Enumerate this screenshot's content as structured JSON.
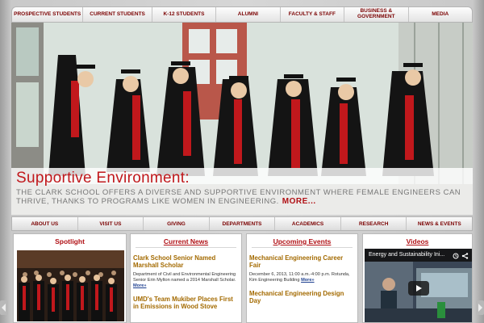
{
  "top_nav": {
    "items": [
      {
        "label": "Prospective Students"
      },
      {
        "label": "Current Students"
      },
      {
        "label": "K-12 Students"
      },
      {
        "label": "Alumni"
      },
      {
        "label": "Faculty & Staff"
      },
      {
        "label": "Business & Government"
      },
      {
        "label": "Media"
      }
    ]
  },
  "hero": {
    "title": "Supportive Environment:",
    "text": "The Clark School offers a diverse and supportive environment where female engineers can thrive, thanks to programs like Women in Engineering.",
    "more_label": "MORE..."
  },
  "sub_nav": {
    "items": [
      {
        "label": "About Us"
      },
      {
        "label": "Visit Us"
      },
      {
        "label": "Giving"
      },
      {
        "label": "Departments"
      },
      {
        "label": "Academics"
      },
      {
        "label": "Research"
      },
      {
        "label": "News & Events"
      }
    ]
  },
  "spotlight": {
    "title": "Spotlight"
  },
  "current_news": {
    "title": "Current News",
    "items": [
      {
        "title": "Clark School Senior Named Marshall Scholar",
        "body": "Department of Civil and Environmental Engineering Senior Erin Mylton named a 2014 Marshall Scholar.",
        "link": "More»"
      },
      {
        "title": "UMD's Team Mukiber Places First in Emissions in Wood Stove",
        "body": "",
        "link": ""
      }
    ]
  },
  "upcoming_events": {
    "title": "Upcoming Events",
    "items": [
      {
        "title": "Mechanical Engineering Career Fair",
        "body": "December 6, 2013, 11:00 a.m.-4:00 p.m. Rotunda, Kim Engineering Building",
        "link": "More»"
      },
      {
        "title": "Mechanical Engineering Design Day",
        "body": "",
        "link": ""
      }
    ]
  },
  "videos": {
    "title": "Videos",
    "video_title": "Energy and Sustainability Ini..."
  },
  "colors": {
    "brand_red": "#c1181c",
    "nav_text": "#7a0000",
    "entry_title": "#a36a00",
    "link_blue": "#1d3f8f"
  },
  "icons": [
    "chevron-left-icon",
    "chevron-right-icon",
    "clock-icon",
    "share-icon",
    "play-icon"
  ]
}
